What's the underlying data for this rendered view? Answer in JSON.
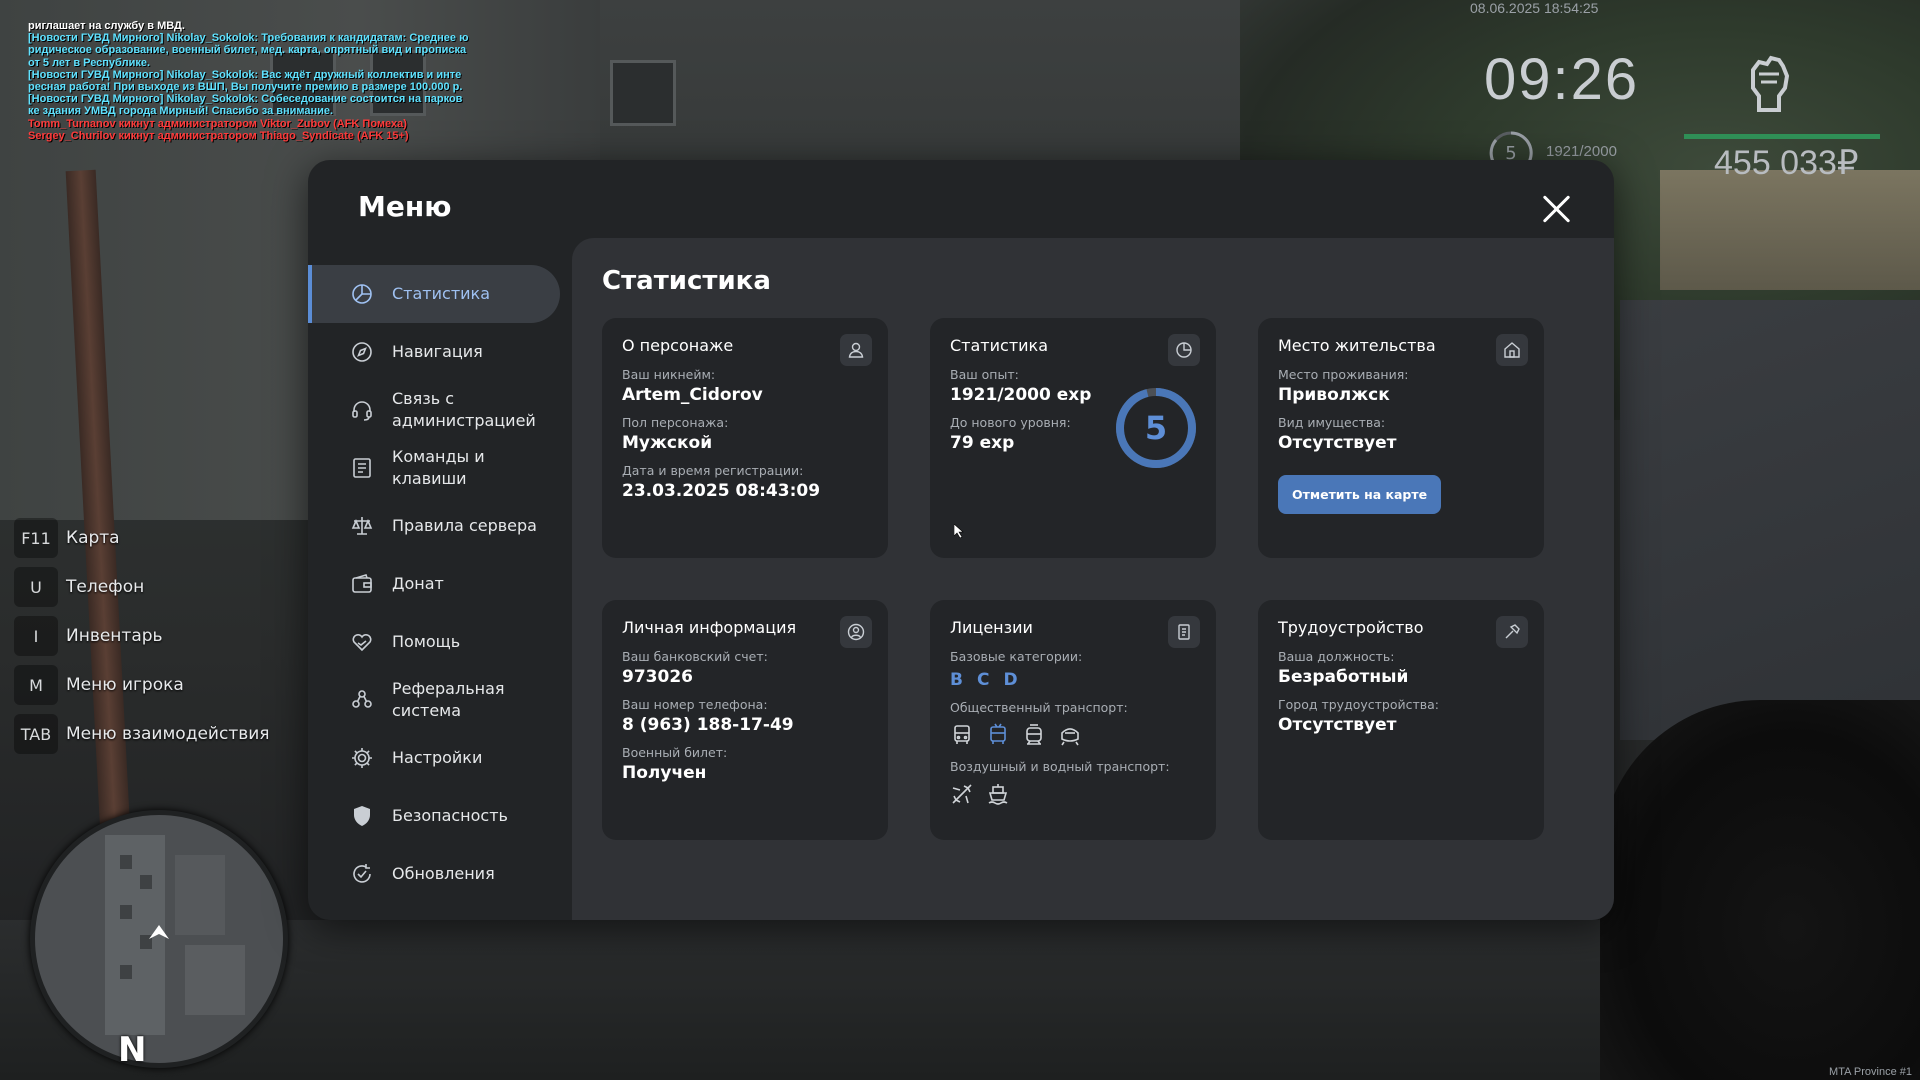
{
  "chat": [
    {
      "text": "риглашает на службу в МВД.",
      "color": "white"
    },
    {
      "text": "[Новости ГУВД Мирного] Nikolay_Sokolok: Требования к кандидатам: Среднее ю",
      "color": "news"
    },
    {
      "text": "ридическое образование, военный билет, мед. карта, опрятный вид и прописка",
      "color": "news"
    },
    {
      "text": "от 5 лет в Республике.",
      "color": "news"
    },
    {
      "text": "[Новости ГУВД Мирного] Nikolay_Sokolok: Вас ждёт дружный коллектив и инте",
      "color": "news"
    },
    {
      "text": "ресная работа! При выходе из ВШП, Вы получите премию в размере 100.000 р.",
      "color": "news"
    },
    {
      "text": "[Новости ГУВД Мирного] Nikolay_Sokolok: Собеседование состоится на парков",
      "color": "news"
    },
    {
      "text": "ке здания УМВД города Мирный! Спасибо за внимание.",
      "color": "news"
    },
    {
      "text": "Tomm_Turnanov кикнут администратором Viktor_Zubov (AFK Помеха)",
      "color": "red"
    },
    {
      "text": "Sergey_Churilov кикнут администратором Thiago_Syndicate (AFK 15+)",
      "color": "red"
    }
  ],
  "hud": {
    "date": "08.06.2025 18:54:25",
    "time": "09:26",
    "level": "5",
    "exp": "1921/2000",
    "money": "455 033₽",
    "fist_icon": "fist-icon"
  },
  "hotkeys": [
    {
      "key": "F11",
      "label": "Карта"
    },
    {
      "key": "U",
      "label": "Телефон"
    },
    {
      "key": "I",
      "label": "Инвентарь"
    },
    {
      "key": "M",
      "label": "Меню игрока"
    },
    {
      "key": "TAB",
      "label": "Меню взаимодействия"
    }
  ],
  "minimap": {
    "north": "N"
  },
  "watermark": "MTA Province #1",
  "menu": {
    "title": "Меню",
    "sidebar": [
      {
        "label": "Статистика",
        "icon": "pie-chart-icon",
        "active": true
      },
      {
        "label": "Навигация",
        "icon": "compass-icon"
      },
      {
        "label": "Связь с администрацией",
        "icon": "headset-icon"
      },
      {
        "label": "Команды и клавиши",
        "icon": "list-icon"
      },
      {
        "label": "Правила сервера",
        "icon": "scales-icon"
      },
      {
        "label": "Донат",
        "icon": "wallet-icon"
      },
      {
        "label": "Помощь",
        "icon": "heart-hands-icon"
      },
      {
        "label": "Реферальная система",
        "icon": "people-icon"
      },
      {
        "label": "Настройки",
        "icon": "gear-icon"
      },
      {
        "label": "Безопасность",
        "icon": "shield-icon"
      },
      {
        "label": "Обновления",
        "icon": "refresh-check-icon"
      }
    ],
    "content_title": "Статистика",
    "cards": {
      "character": {
        "title": "О персонаже",
        "icon": "user-icon",
        "nick_label": "Ваш никнейм:",
        "nick": "Artem_Cidorov",
        "gender_label": "Пол персонажа:",
        "gender": "Мужской",
        "reg_label": "Дата и время регистрации:",
        "reg": "23.03.2025 08:43:09"
      },
      "stats": {
        "title": "Статистика",
        "icon": "clock-pie-icon",
        "exp_label": "Ваш опыт:",
        "exp": "1921/2000 exp",
        "next_label": "До нового уровня:",
        "next": "79 exp",
        "level": "5",
        "progress": 0.96
      },
      "residence": {
        "title": "Место жительства",
        "icon": "home-icon",
        "place_label": "Место проживания:",
        "place": "Приволжск",
        "property_label": "Вид имущества:",
        "property": "Отсутствует",
        "button": "Отметить на карте"
      },
      "personal": {
        "title": "Личная информация",
        "icon": "user-circle-icon",
        "bank_label": "Ваш банковский счет:",
        "bank": "973026",
        "phone_label": "Ваш номер телефона:",
        "phone": "8 (963) 188-17-49",
        "military_label": "Военный билет:",
        "military": "Получен"
      },
      "licenses": {
        "title": "Лицензии",
        "icon": "document-icon",
        "base_label": "Базовые категории:",
        "base": [
          "B",
          "C",
          "D"
        ],
        "public_label": "Общественный транспорт:",
        "public_icons": [
          {
            "icon": "bus-icon",
            "active": false
          },
          {
            "icon": "trolleybus-icon",
            "active": true
          },
          {
            "icon": "tram-icon",
            "active": false
          },
          {
            "icon": "train-icon",
            "active": false
          }
        ],
        "air_label": "Воздушный и водный транспорт:",
        "air_icons": [
          {
            "icon": "plane-icon",
            "active": false
          },
          {
            "icon": "ship-icon",
            "active": false
          }
        ]
      },
      "job": {
        "title": "Трудоустройство",
        "icon": "hammer-icon",
        "position_label": "Ваша должность:",
        "position": "Безработный",
        "city_label": "Город трудоустройства:",
        "city": "Отсутствует"
      }
    }
  },
  "colors": {
    "accent": "#5e8fd7",
    "button": "#4a77b8",
    "news": "#5fe2ff",
    "red": "#ff3b3b"
  }
}
